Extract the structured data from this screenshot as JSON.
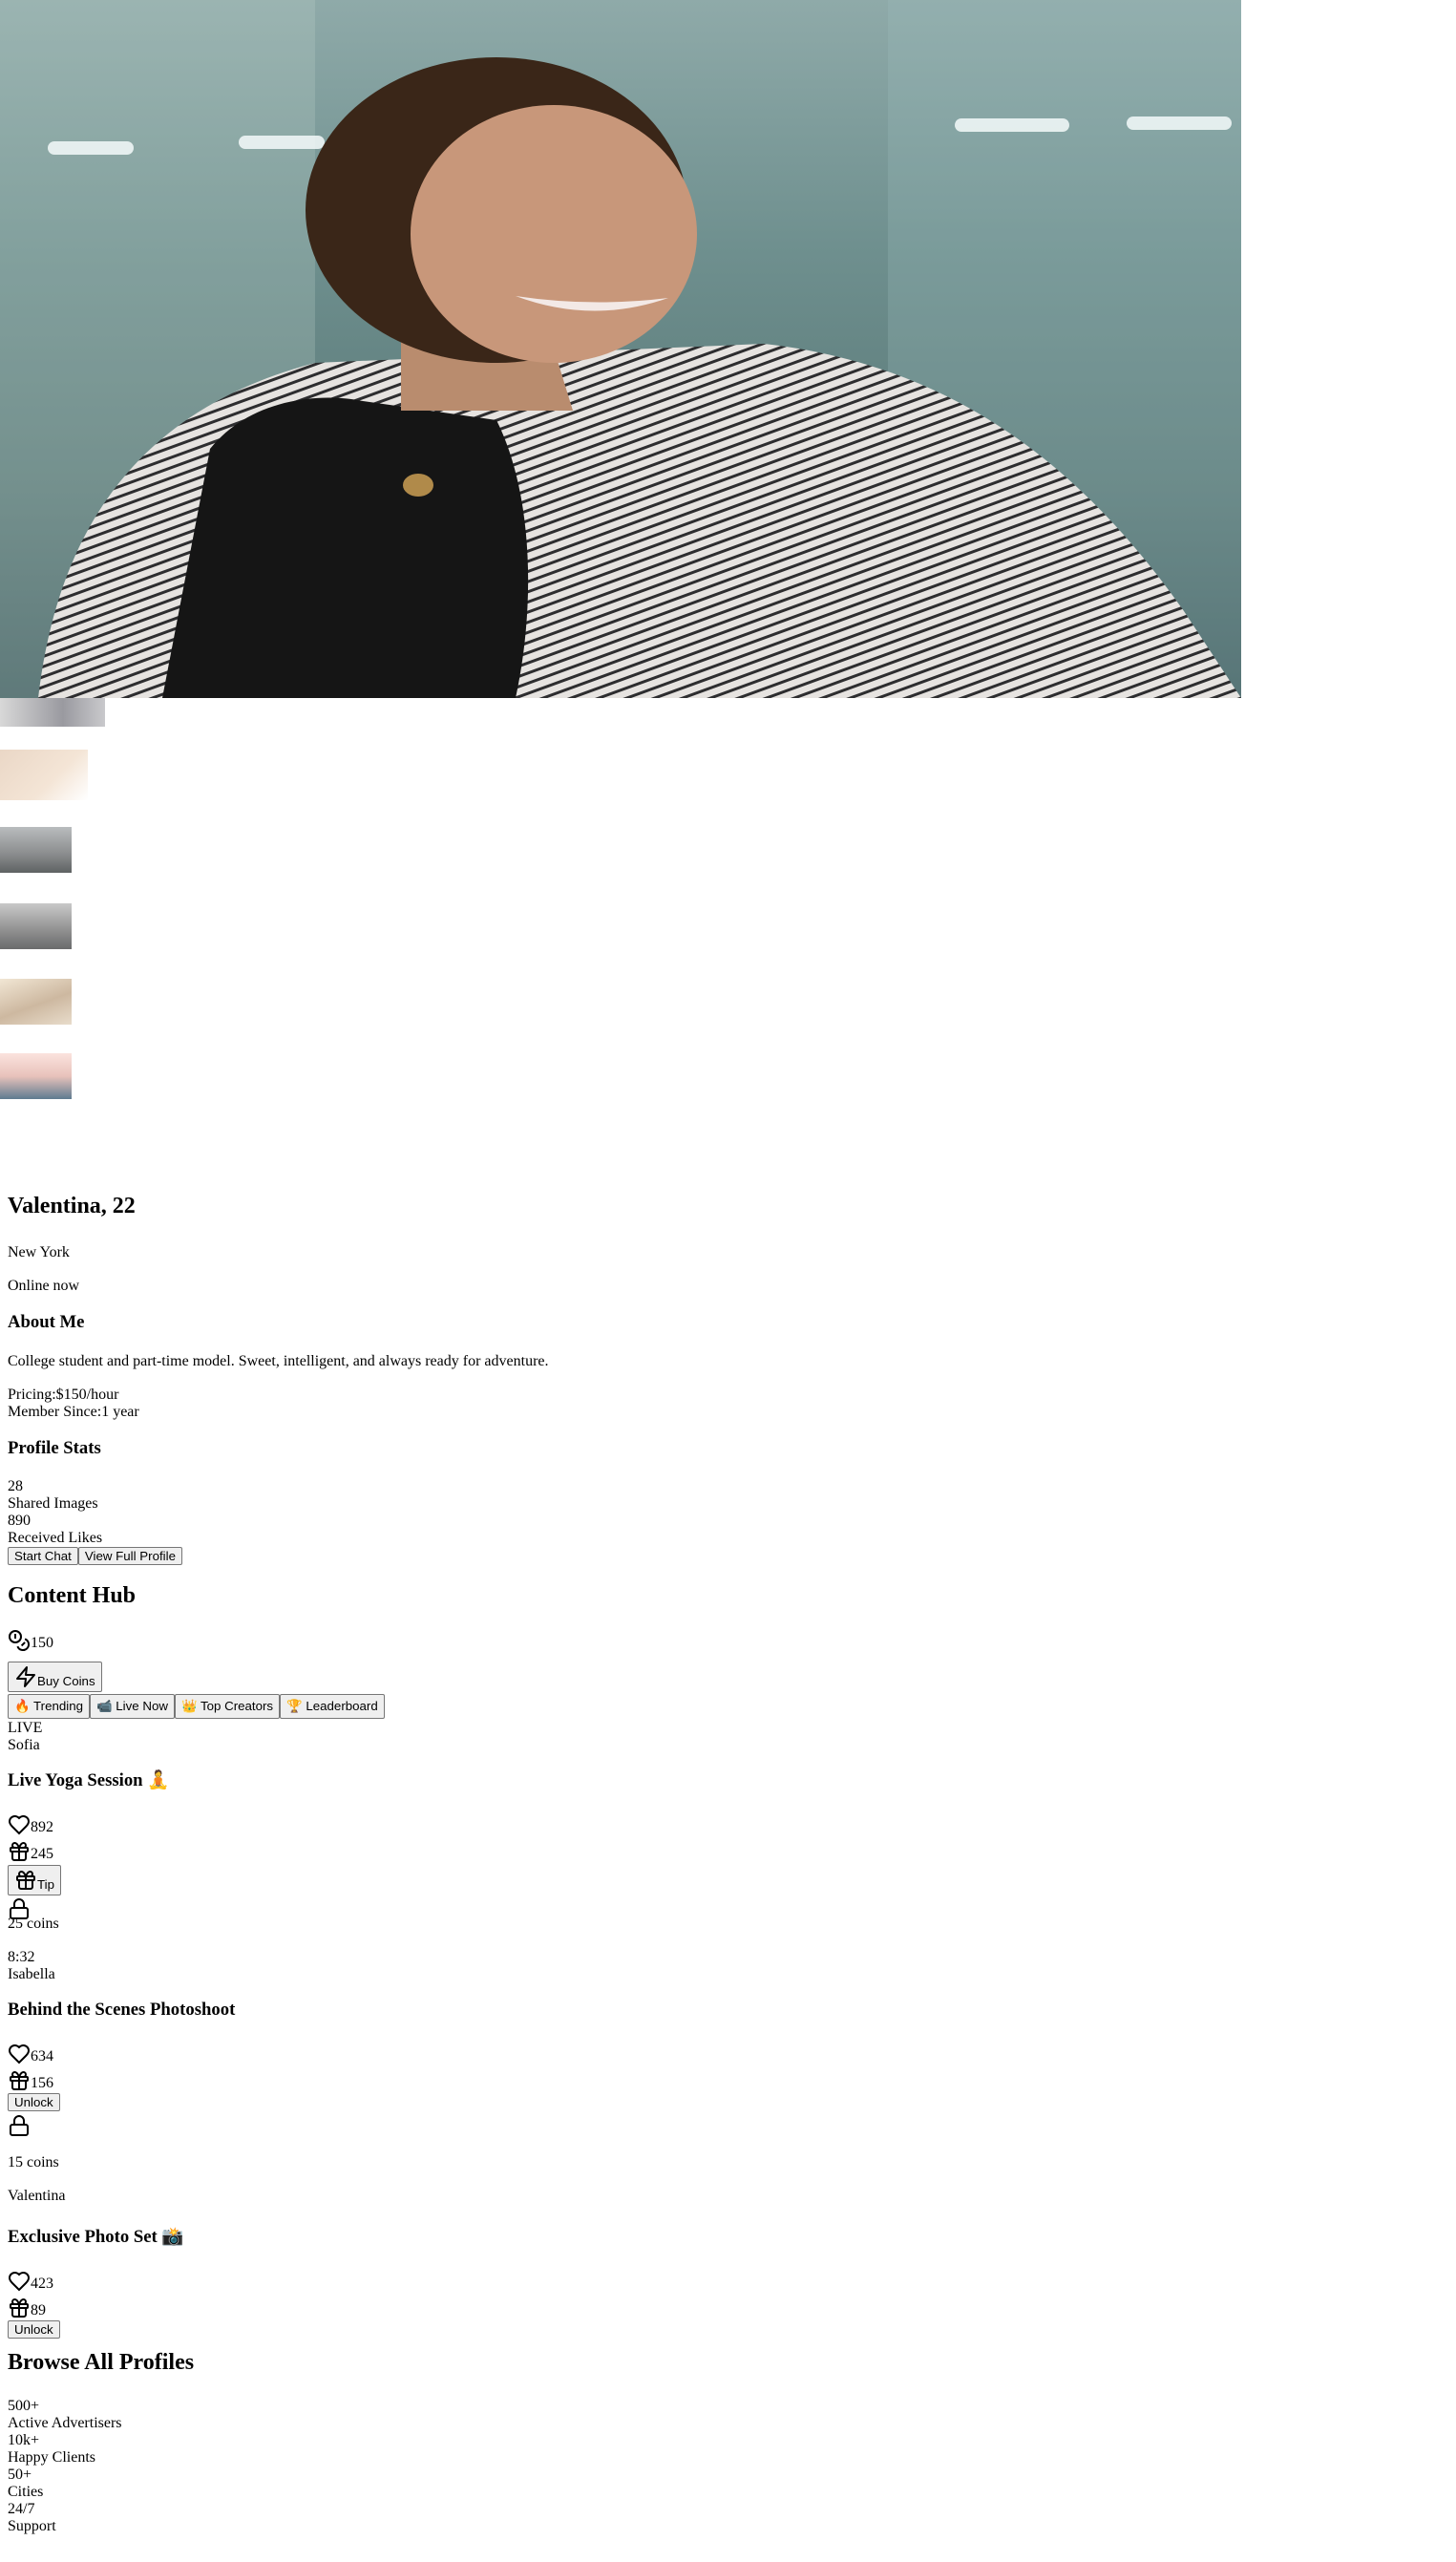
{
  "profile": {
    "name_age": "Valentina, 22",
    "location": "New York",
    "status": "Online now",
    "about_heading": "About Me",
    "about_text": "College student and part-time model. Sweet, intelligent, and always ready for adventure.",
    "pricing_label": "Pricing:",
    "pricing_value": "$150/hour",
    "member_label": "Member Since:",
    "member_value": "1 year",
    "stats_heading": "Profile Stats",
    "stats": [
      {
        "value": "28",
        "label": "Shared Images"
      },
      {
        "value": "890",
        "label": "Received Likes"
      }
    ],
    "start_chat": "Start Chat",
    "view_profile": "View Full Profile"
  },
  "hub": {
    "title": "Content Hub",
    "coins": "150",
    "buy_coins": "Buy Coins",
    "tabs": [
      "🔥 Trending",
      "📹 Live Now",
      "👑 Top Creators",
      "🏆 Leaderboard"
    ],
    "posts": [
      {
        "badge": "LIVE",
        "creator": "Sofia",
        "title": "Live Yoga Session 🧘",
        "likes": "892",
        "gifts": "245",
        "tip": "Tip",
        "price": "25 coins",
        "duration": "8:32"
      },
      {
        "creator": "Isabella",
        "title": "Behind the Scenes Photoshoot",
        "likes": "634",
        "gifts": "156",
        "unlock": "Unlock",
        "price": "15 coins"
      },
      {
        "creator": "Valentina",
        "title": "Exclusive Photo Set 📸",
        "likes": "423",
        "gifts": "89",
        "unlock": "Unlock"
      }
    ]
  },
  "browse": {
    "title": "Browse All Profiles",
    "stats": [
      {
        "value": "500+",
        "label": "Active Advertisers"
      },
      {
        "value": "10k+",
        "label": "Happy Clients"
      },
      {
        "value": "50+",
        "label": "Cities"
      },
      {
        "value": "24/7",
        "label": "Support"
      }
    ]
  }
}
